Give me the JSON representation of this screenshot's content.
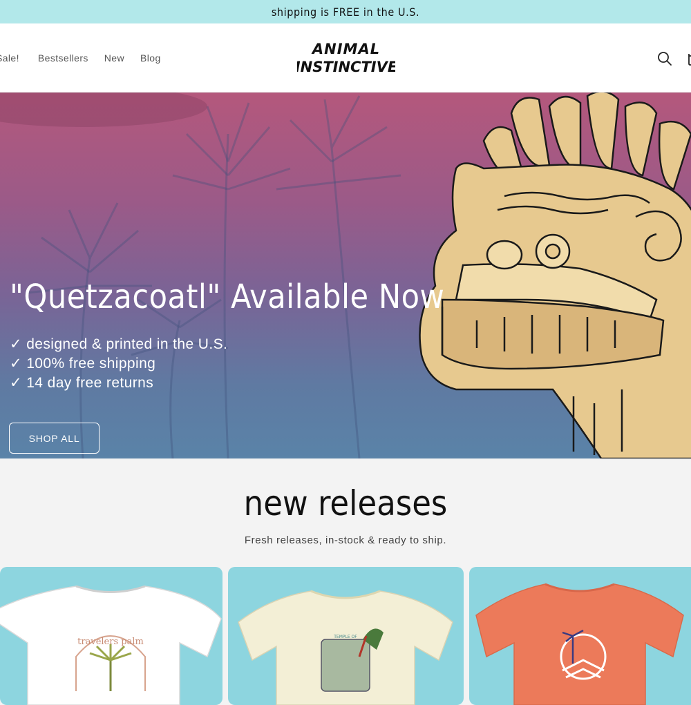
{
  "announcement": "shipping is FREE in the U.S.",
  "header": {
    "nav": [
      "Sale!",
      "Bestsellers",
      "New",
      "Blog"
    ],
    "logo": {
      "line1": "ANIMAL",
      "line2": "INSTINCTIVE"
    },
    "icons": [
      "search-icon",
      "cart-icon"
    ]
  },
  "hero": {
    "title": "\"Quetzacoatl\" Available Now",
    "features": [
      "✓ designed & printed in the U.S.",
      "✓ 100% free shipping",
      "✓ 14 day free returns"
    ],
    "cta": "SHOP ALL"
  },
  "releases": {
    "title": "new releases",
    "subtitle": "Fresh releases, in-stock & ready to ship.",
    "products": [
      {
        "color": "#ffffff",
        "graphic": "travelers palm"
      },
      {
        "color": "#f3efd6",
        "graphic": "TEMPLE OF"
      },
      {
        "color": "#ec7a5a",
        "graphic": ""
      }
    ]
  },
  "colors": {
    "announcement_bg": "#b2e8ea",
    "card_bg": "#8dd5df",
    "hero_top": "#b4587c",
    "hero_bottom": "#5a83a8"
  }
}
